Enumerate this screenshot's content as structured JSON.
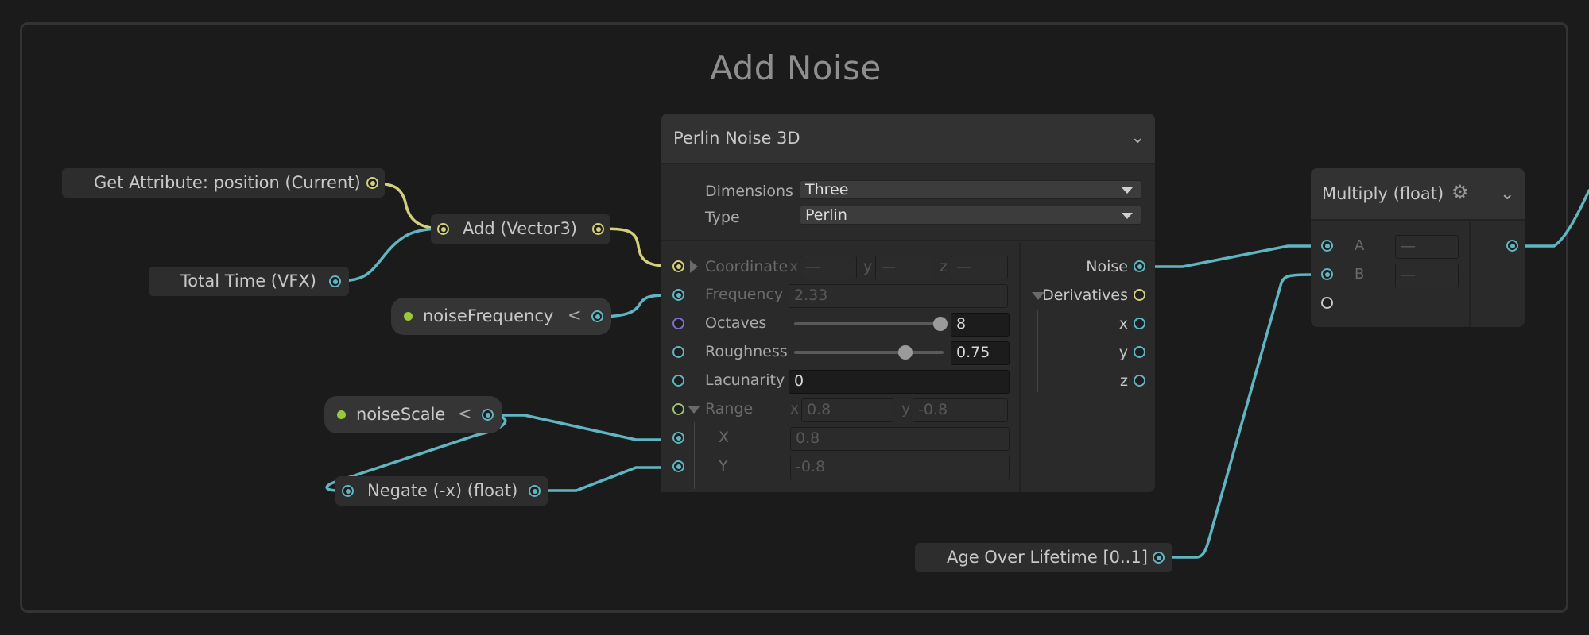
{
  "group": {
    "title": "Add Noise"
  },
  "nodes": {
    "get_attribute": {
      "label": "Get Attribute: position (Current)"
    },
    "total_time": {
      "label": "Total Time (VFX)"
    },
    "add_vector3": {
      "label": "Add (Vector3)"
    },
    "noise_frequency": {
      "label": "noiseFrequency",
      "chevron": "<"
    },
    "noise_scale": {
      "label": "noiseScale",
      "chevron": "<"
    },
    "negate": {
      "label": "Negate (-x) (float)"
    },
    "age_over_lifetime": {
      "label": "Age Over Lifetime [0..1]"
    },
    "perlin": {
      "title": "Perlin Noise 3D",
      "dimensions_label": "Dimensions",
      "dimensions_value": "Three",
      "type_label": "Type",
      "type_value": "Perlin",
      "inputs": {
        "coordinate": "Coordinate",
        "coord_x": "x",
        "coord_y": "y",
        "coord_z": "z",
        "coord_x_value": "—",
        "coord_y_value": "—",
        "coord_z_value": "—",
        "frequency": "Frequency",
        "frequency_value": "2.33",
        "octaves": "Octaves",
        "octaves_value": "8",
        "octaves_level": 1.0,
        "roughness": "Roughness",
        "roughness_value": "0.75",
        "roughness_level": 0.75,
        "lacunarity": "Lacunarity",
        "lacunarity_value": "0",
        "range": "Range",
        "range_x": "x",
        "range_y": "y",
        "range_x_value": "0.8",
        "range_y_value": "-0.8",
        "X": "X",
        "X_value": "0.8",
        "Y": "Y",
        "Y_value": "-0.8"
      },
      "outputs": {
        "noise": "Noise",
        "derivatives": "Derivatives",
        "x": "x",
        "y": "y",
        "z": "z"
      }
    },
    "multiply": {
      "title": "Multiply (float)",
      "a": "A",
      "a_value": "—",
      "b": "B",
      "b_value": "—"
    }
  },
  "colors": {
    "float_wire": "#5fb6c2",
    "vector_wire": "#d4d07a",
    "property_dot": "#98c93a"
  }
}
